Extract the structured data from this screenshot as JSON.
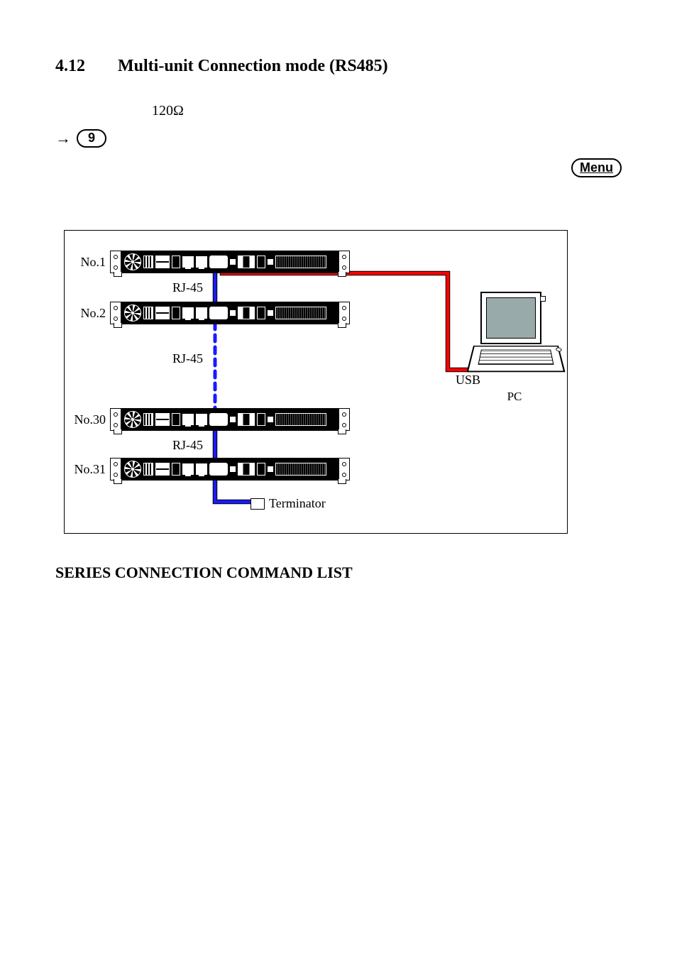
{
  "heading": {
    "number": "4.12",
    "title": "Multi-unit Connection mode (RS485)"
  },
  "resistor_value": "120Ω",
  "arrow_glyph": "→",
  "step_button_label": "9",
  "menu_button_label": "Menu",
  "diagram": {
    "units": [
      {
        "label": "No.1"
      },
      {
        "label": "No.2"
      },
      {
        "label": "No.30"
      },
      {
        "label": "No.31"
      }
    ],
    "rj_labels": [
      "RJ-45",
      "RJ-45",
      "RJ-45"
    ],
    "terminator_label": "Terminator",
    "usb_label": "USB",
    "pc_label": "PC"
  },
  "series_heading": "SERIES CONNECTION COMMAND LIST"
}
